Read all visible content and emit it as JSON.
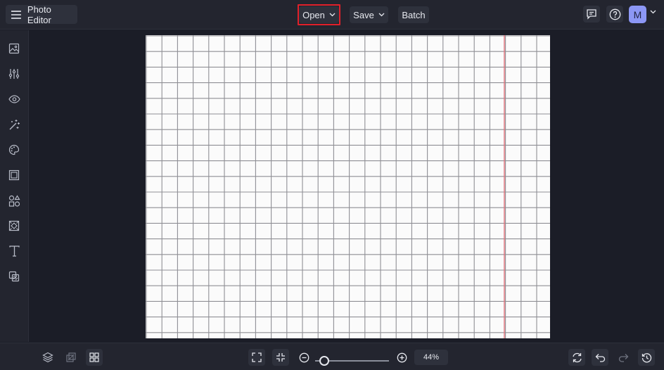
{
  "header": {
    "app_title": "Photo Editor",
    "open_label": "Open",
    "save_label": "Save",
    "batch_label": "Batch",
    "avatar_letter": "M"
  },
  "sidebar": {
    "items": [
      {
        "icon": "image-icon"
      },
      {
        "icon": "adjustments-icon"
      },
      {
        "icon": "eye-icon"
      },
      {
        "icon": "magic-sparkle-icon"
      },
      {
        "icon": "palette-icon"
      },
      {
        "icon": "frame-icon"
      },
      {
        "icon": "shapes-icon"
      },
      {
        "icon": "texture-icon"
      },
      {
        "icon": "text-icon"
      },
      {
        "icon": "overlay-icon"
      }
    ]
  },
  "canvas": {
    "content": "graph paper image",
    "grid_color": "#8f8f95",
    "margin_line_color": "#e0707a"
  },
  "footer": {
    "zoom_value": "44%",
    "zoom_fraction": 0.12
  },
  "colors": {
    "accent": "#8c97f5",
    "highlight": "#e0202a",
    "bar_background": "#23252f",
    "workspace_background": "#1b1d27"
  }
}
